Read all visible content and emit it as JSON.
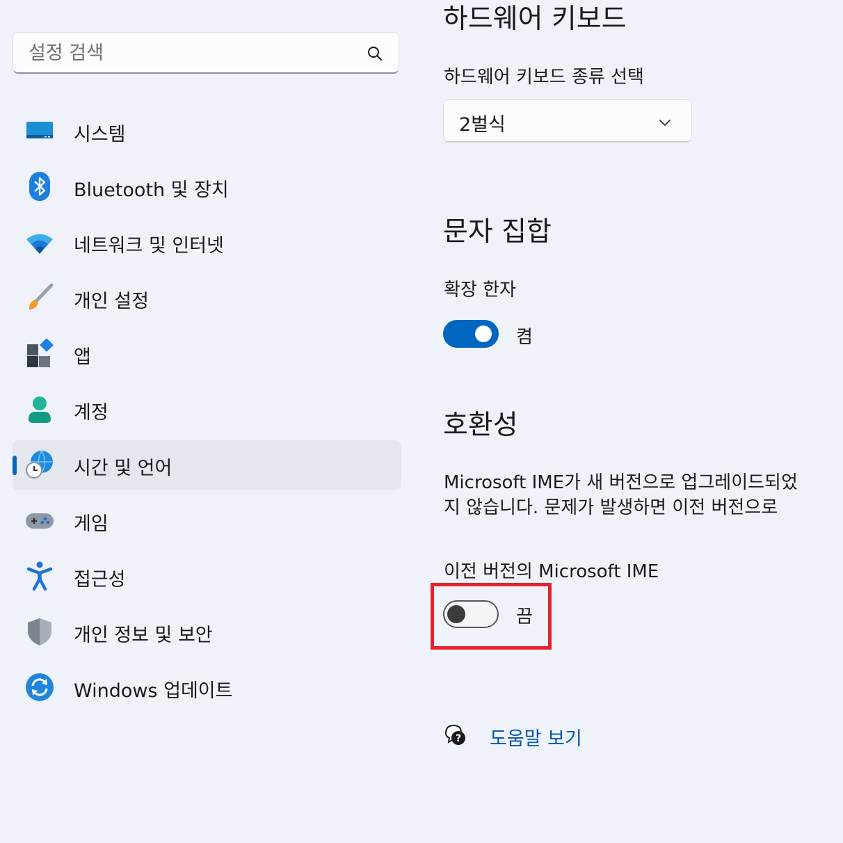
{
  "search": {
    "placeholder": "설정 검색",
    "icon": "search-icon"
  },
  "sidebar": {
    "items": [
      {
        "label": "시스템",
        "icon": "system-monitor-icon"
      },
      {
        "label": "Bluetooth 및 장치",
        "icon": "bluetooth-icon"
      },
      {
        "label": "네트워크 및 인터넷",
        "icon": "wifi-icon"
      },
      {
        "label": "개인 설정",
        "icon": "paintbrush-icon"
      },
      {
        "label": "앱",
        "icon": "apps-icon"
      },
      {
        "label": "계정",
        "icon": "account-icon"
      },
      {
        "label": "시간 및 언어",
        "icon": "time-language-icon",
        "selected": true
      },
      {
        "label": "게임",
        "icon": "gamepad-icon"
      },
      {
        "label": "접근성",
        "icon": "accessibility-icon"
      },
      {
        "label": "개인 정보 및 보안",
        "icon": "shield-icon"
      },
      {
        "label": "Windows 업데이트",
        "icon": "windows-update-icon"
      }
    ]
  },
  "main": {
    "hardware_keyboard": {
      "heading": "하드웨어 키보드",
      "layout_label": "하드웨어 키보드 종류 선택",
      "layout_value": "2벌식"
    },
    "charset": {
      "heading": "문자 집합",
      "extended_hanja_label": "확장 한자",
      "extended_hanja_state": "켬",
      "extended_hanja_on": true
    },
    "compatibility": {
      "heading": "호환성",
      "description_line1": "Microsoft IME가 새 버전으로 업그레이드되었",
      "description_line2": "지 않습니다. 문제가 발생하면 이전 버전으로 ",
      "previous_ime_label": "이전 버전의 Microsoft IME",
      "previous_ime_state": "끔",
      "previous_ime_on": false
    },
    "help_link": "도움말 보기"
  },
  "colors": {
    "background": "#eff3f9",
    "accent": "#0067c0",
    "link": "#0055b0",
    "highlight": "#e3232e"
  }
}
